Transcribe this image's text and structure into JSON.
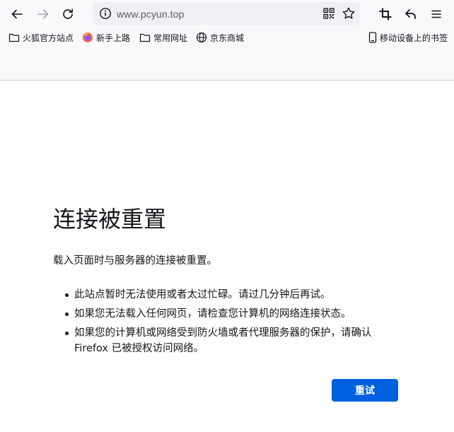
{
  "toolbar": {
    "url": "www.pcyun.top"
  },
  "bookmarks": {
    "items": [
      {
        "label": "火狐官方站点",
        "icon": "folder-icon"
      },
      {
        "label": "新手上路",
        "icon": "firefox-icon"
      },
      {
        "label": "常用网址",
        "icon": "folder-icon"
      },
      {
        "label": "京东商城",
        "icon": "globe-icon"
      }
    ],
    "mobile": {
      "label": "移动设备上的书签",
      "icon": "mobile-device-icon"
    }
  },
  "error": {
    "title": "连接被重置",
    "description": "载入页面时与服务器的连接被重置。",
    "reasons": [
      "此站点暂时无法使用或者太过忙碌。请过几分钟后再试。",
      "如果您无法载入任何网页，请检查您计算机的网络连接状态。",
      "如果您的计算机或网络受到防火墙或者代理服务器的保护，请确认 Firefox 已被授权访问网络。"
    ],
    "retry_label": "重试"
  },
  "colors": {
    "accent": "#0061e0",
    "chrome_bg": "#f9f9fb",
    "urlbar_bg": "#f0f0f4",
    "text": "#15141a"
  }
}
